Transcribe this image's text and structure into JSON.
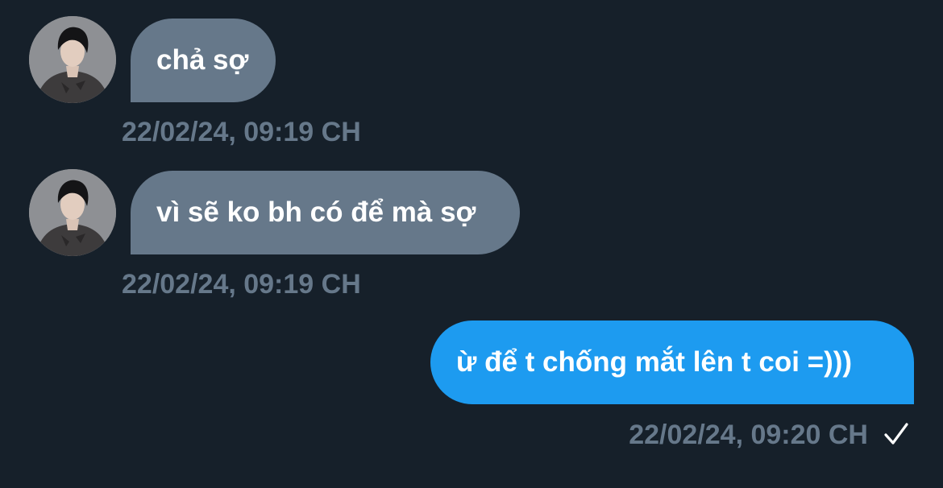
{
  "conversation": {
    "messages": [
      {
        "direction": "received",
        "text": "chả sợ",
        "timestamp": "22/02/24, 09:19 CH"
      },
      {
        "direction": "received",
        "text": "vì sẽ ko bh có để mà sợ",
        "timestamp": "22/02/24, 09:19 CH"
      },
      {
        "direction": "sent",
        "text": "ừ để t chống mắt lên t coi =)))",
        "timestamp": "22/02/24, 09:20 CH",
        "status_icon": "check-icon"
      }
    ]
  },
  "colors": {
    "background": "#16202a",
    "received_bubble": "#66788a",
    "sent_bubble": "#1d9bf0",
    "timestamp": "#66788a",
    "text": "#ffffff"
  }
}
